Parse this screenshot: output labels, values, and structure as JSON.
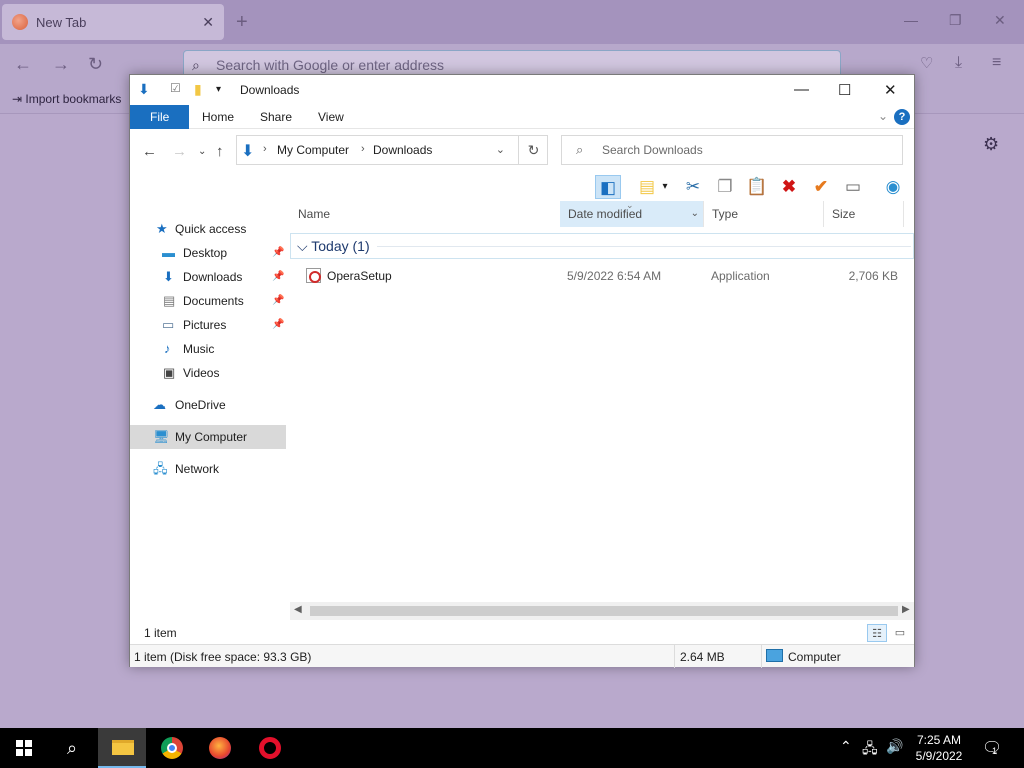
{
  "browser": {
    "tab_title": "New Tab",
    "tab_close": "✕",
    "new_tab": "+",
    "url_placeholder": "Search with Google or enter address",
    "import_bookmarks": "Import bookmarks"
  },
  "explorer": {
    "title": "Downloads",
    "ribbon_tabs": [
      "File",
      "Home",
      "Share",
      "View"
    ],
    "help": "?",
    "address": {
      "crumb1": "My Computer",
      "crumb2": "Downloads"
    },
    "search_placeholder": "Search Downloads",
    "nav": {
      "quick_access": "Quick access",
      "desktop": "Desktop",
      "downloads": "Downloads",
      "documents": "Documents",
      "pictures": "Pictures",
      "music": "Music",
      "videos": "Videos",
      "onedrive": "OneDrive",
      "my_computer": "My Computer",
      "network": "Network"
    },
    "columns": {
      "name": "Name",
      "date": "Date modified",
      "type": "Type",
      "size": "Size"
    },
    "group_label": "Today (1)",
    "files": [
      {
        "name": "OperaSetup",
        "date": "5/9/2022 6:54 AM",
        "type": "Application",
        "size": "2,706 KB"
      }
    ],
    "item_count": "1 item",
    "status": {
      "left": "1 item (Disk free space: 93.3 GB)",
      "size": "2.64 MB",
      "location": "Computer"
    }
  },
  "taskbar": {
    "time": "7:25 AM",
    "date": "5/9/2022",
    "notifications": "1"
  },
  "colors": {
    "accent": "#1a6fc0",
    "browser_bg": "#b9a9cc",
    "taskbar": "#000000"
  }
}
